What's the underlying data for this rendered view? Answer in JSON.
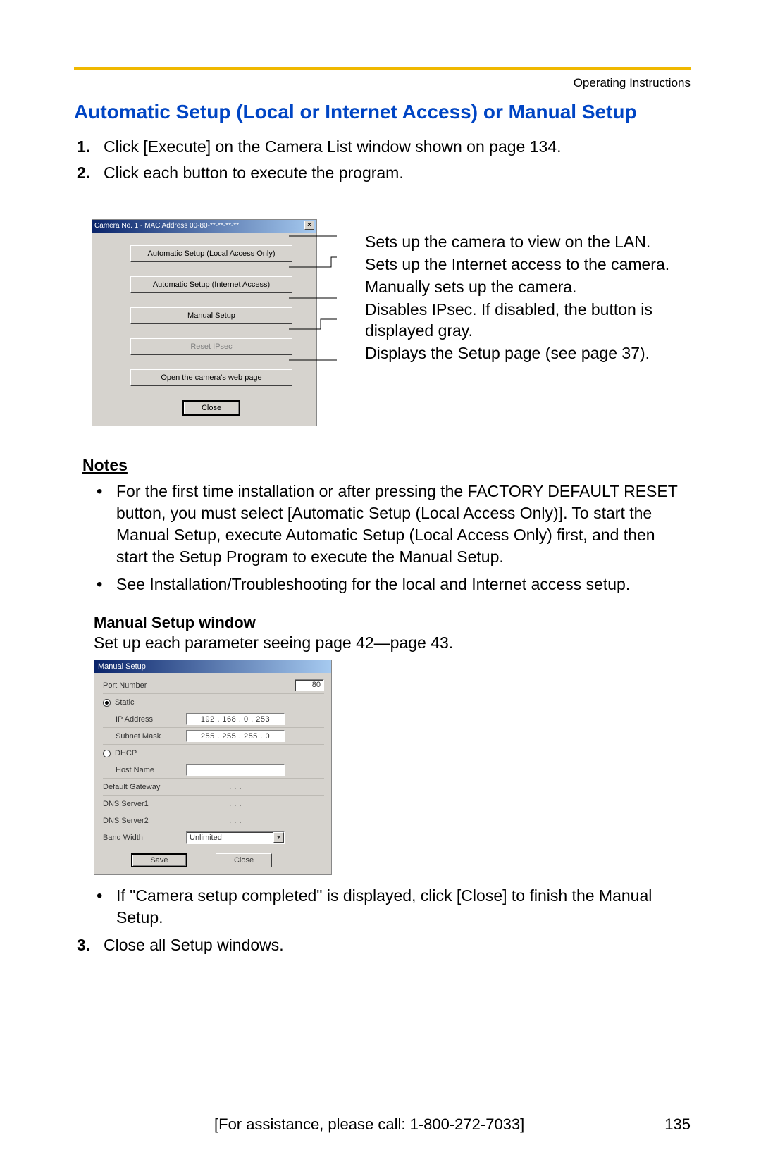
{
  "header": {
    "label": "Operating Instructions"
  },
  "title": "Automatic Setup (Local or Internet Access) or Manual Setup",
  "steps": {
    "s1": "Click [Execute] on the Camera List window shown on page 134.",
    "s2": "Click each button to execute the program.",
    "s3": "Close all Setup windows."
  },
  "dialog1": {
    "titlebar": "Camera No. 1   -   MAC Address   00-80-**-**-**-**",
    "btn_local": "Automatic Setup (Local Access Only)",
    "btn_internet": "Automatic Setup (Internet Access)",
    "btn_manual": "Manual Setup",
    "btn_ipsec": "Reset IPsec",
    "btn_webpage": "Open the camera's web page",
    "btn_close": "Close"
  },
  "callouts": {
    "c1": "Sets up the camera to view on the LAN.",
    "c2": "Sets up the Internet access to the camera.",
    "c3": "Manually sets up the camera.",
    "c4": "Disables IPsec. If disabled, the button is displayed gray.",
    "c5": "Displays the Setup page (see page 37)."
  },
  "notes": {
    "heading": "Notes",
    "n1": "For the first time installation or after pressing the FACTORY DEFAULT RESET button, you must select [Automatic Setup (Local Access Only)]. To start the Manual Setup, execute Automatic Setup (Local Access Only) first, and then start the Setup Program to execute the Manual Setup.",
    "n2": "See Installation/Troubleshooting for the local and Internet access setup."
  },
  "manual_setup": {
    "heading": "Manual Setup window",
    "intro": "Set up each parameter seeing page 42—page 43.",
    "dlg_title": "Manual Setup",
    "labels": {
      "port": "Port Number",
      "static": "Static",
      "ip": "IP Address",
      "mask": "Subnet Mask",
      "dhcp": "DHCP",
      "host": "Host Name",
      "gateway": "Default Gateway",
      "dns1": "DNS Server1",
      "dns2": "DNS Server2",
      "bw": "Band Width"
    },
    "values": {
      "port": "80",
      "ip": "192 . 168 .  0  . 253",
      "mask": "255 . 255 . 255 .  0",
      "gateway": " .       .       . ",
      "dns1": " .       .       . ",
      "dns2": " .       .       . ",
      "bw": "Unlimited"
    },
    "btn_save": "Save",
    "btn_close": "Close",
    "after": "If \"Camera setup completed\" is displayed, click [Close] to finish the Manual Setup."
  },
  "footer": {
    "assist": "[For assistance, please call: 1-800-272-7033]",
    "pagenum": "135"
  }
}
